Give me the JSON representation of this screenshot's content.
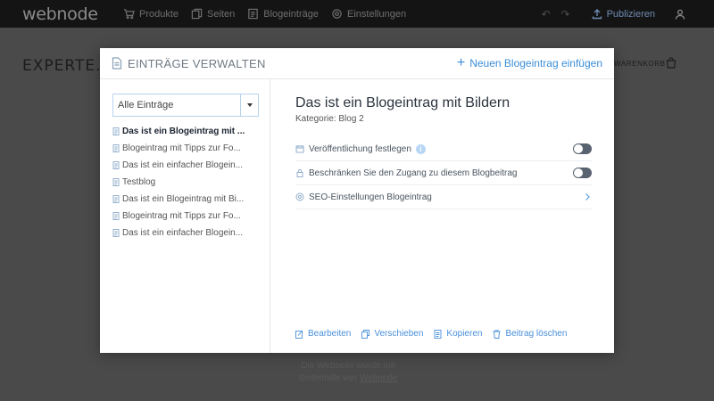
{
  "topbar": {
    "logo": "webnode",
    "nav": [
      {
        "label": "Produkte",
        "icon": "cart-icon"
      },
      {
        "label": "Seiten",
        "icon": "pages-icon"
      },
      {
        "label": "Blogeinträge",
        "icon": "blog-icon"
      },
      {
        "label": "Einstellungen",
        "icon": "gear-icon"
      }
    ],
    "undo_icon": "undo-icon",
    "redo_icon": "redo-icon",
    "publish_label": "Publizieren",
    "user_icon": "user-icon"
  },
  "page": {
    "site_title": "EXPERTE.DE",
    "cart_label": "WARENKORB",
    "footer_line1": "Die Webseite wurde mit",
    "footer_line2_prefix": "Webnode",
    "footer_line2": "Seitenhilfe von"
  },
  "modal": {
    "title": "EINTRÄGE VERWALTEN",
    "add_label": "Neuen Blogeintrag einfügen",
    "filter": {
      "selected": "Alle Einträge"
    },
    "entries": [
      "Das ist ein Blogeintrag mit ...",
      "Blogeintrag mit Tipps zur Fo...",
      "Das ist ein einfacher Blogein...",
      "Testblog",
      "Das ist ein Blogeintrag mit Bi...",
      "Blogeintrag mit Tipps zur Fo...",
      "Das ist ein einfacher Blogein..."
    ],
    "active_index": 0,
    "post": {
      "title": "Das ist ein Blogeintrag mit Bildern",
      "category": "Kategorie: Blog 2"
    },
    "settings": [
      {
        "label": "Veröffentlichung festlegen",
        "icon": "calendar-icon",
        "control": "toggle",
        "on": false,
        "info": "i"
      },
      {
        "label": "Beschränken Sie den Zugang zu diesem Blogbeitrag",
        "icon": "lock-icon",
        "control": "toggle",
        "on": false
      },
      {
        "label": "SEO-Einstellungen Blogeintrag",
        "icon": "seo-icon",
        "control": "chevron"
      }
    ],
    "actions": [
      {
        "label": "Bearbeiten",
        "icon": "edit-icon"
      },
      {
        "label": "Verschieben",
        "icon": "move-icon"
      },
      {
        "label": "Kopieren",
        "icon": "copy-icon"
      },
      {
        "label": "Beitrag löschen",
        "icon": "trash-icon"
      }
    ]
  },
  "colors": {
    "accent": "#3b8ed8",
    "toggle_off": "#586271",
    "overlay": "#4a4a4a",
    "topbar": "#141414"
  }
}
